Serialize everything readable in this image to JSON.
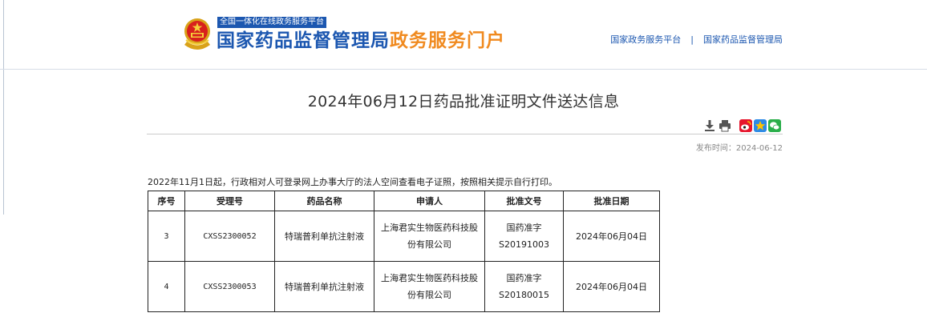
{
  "header": {
    "platform_tag": "全国一体化在线政务服务平台",
    "agency_name": "国家药品监督管理局",
    "portal_name": "政务服务门户",
    "links": [
      "国家政务服务平台",
      "国家药品监督管理局"
    ],
    "link_separator": "|"
  },
  "article": {
    "title": "2024年06月12日药品批准证明文件送达信息",
    "publish_label": "发布时间：",
    "publish_date": "2024-06-12",
    "notice": "2022年11月1日起，行政相对人可登录网上办事大厅的法人空间查看电子证照，按照相关提示自行打印。"
  },
  "toolbar": {
    "icons": [
      "download-icon",
      "print-icon",
      "weibo-icon",
      "qzone-icon",
      "wechat-icon"
    ]
  },
  "table": {
    "columns": [
      "序号",
      "受理号",
      "药品名称",
      "申请人",
      "批准文号",
      "批准日期"
    ],
    "rows": [
      [
        "3",
        "CXSS2300052",
        "特瑞普利单抗注射液",
        "上海君实生物医药科技股份有限公司",
        "国药准字S20191003",
        "2024年06月04日"
      ],
      [
        "4",
        "CXSS2300053",
        "特瑞普利单抗注射液",
        "上海君实生物医药科技股份有限公司",
        "国药准字S20180015",
        "2024年06月04日"
      ]
    ]
  },
  "colors": {
    "brand_blue": "#1c57b0",
    "brand_orange": "#f08a1f"
  }
}
